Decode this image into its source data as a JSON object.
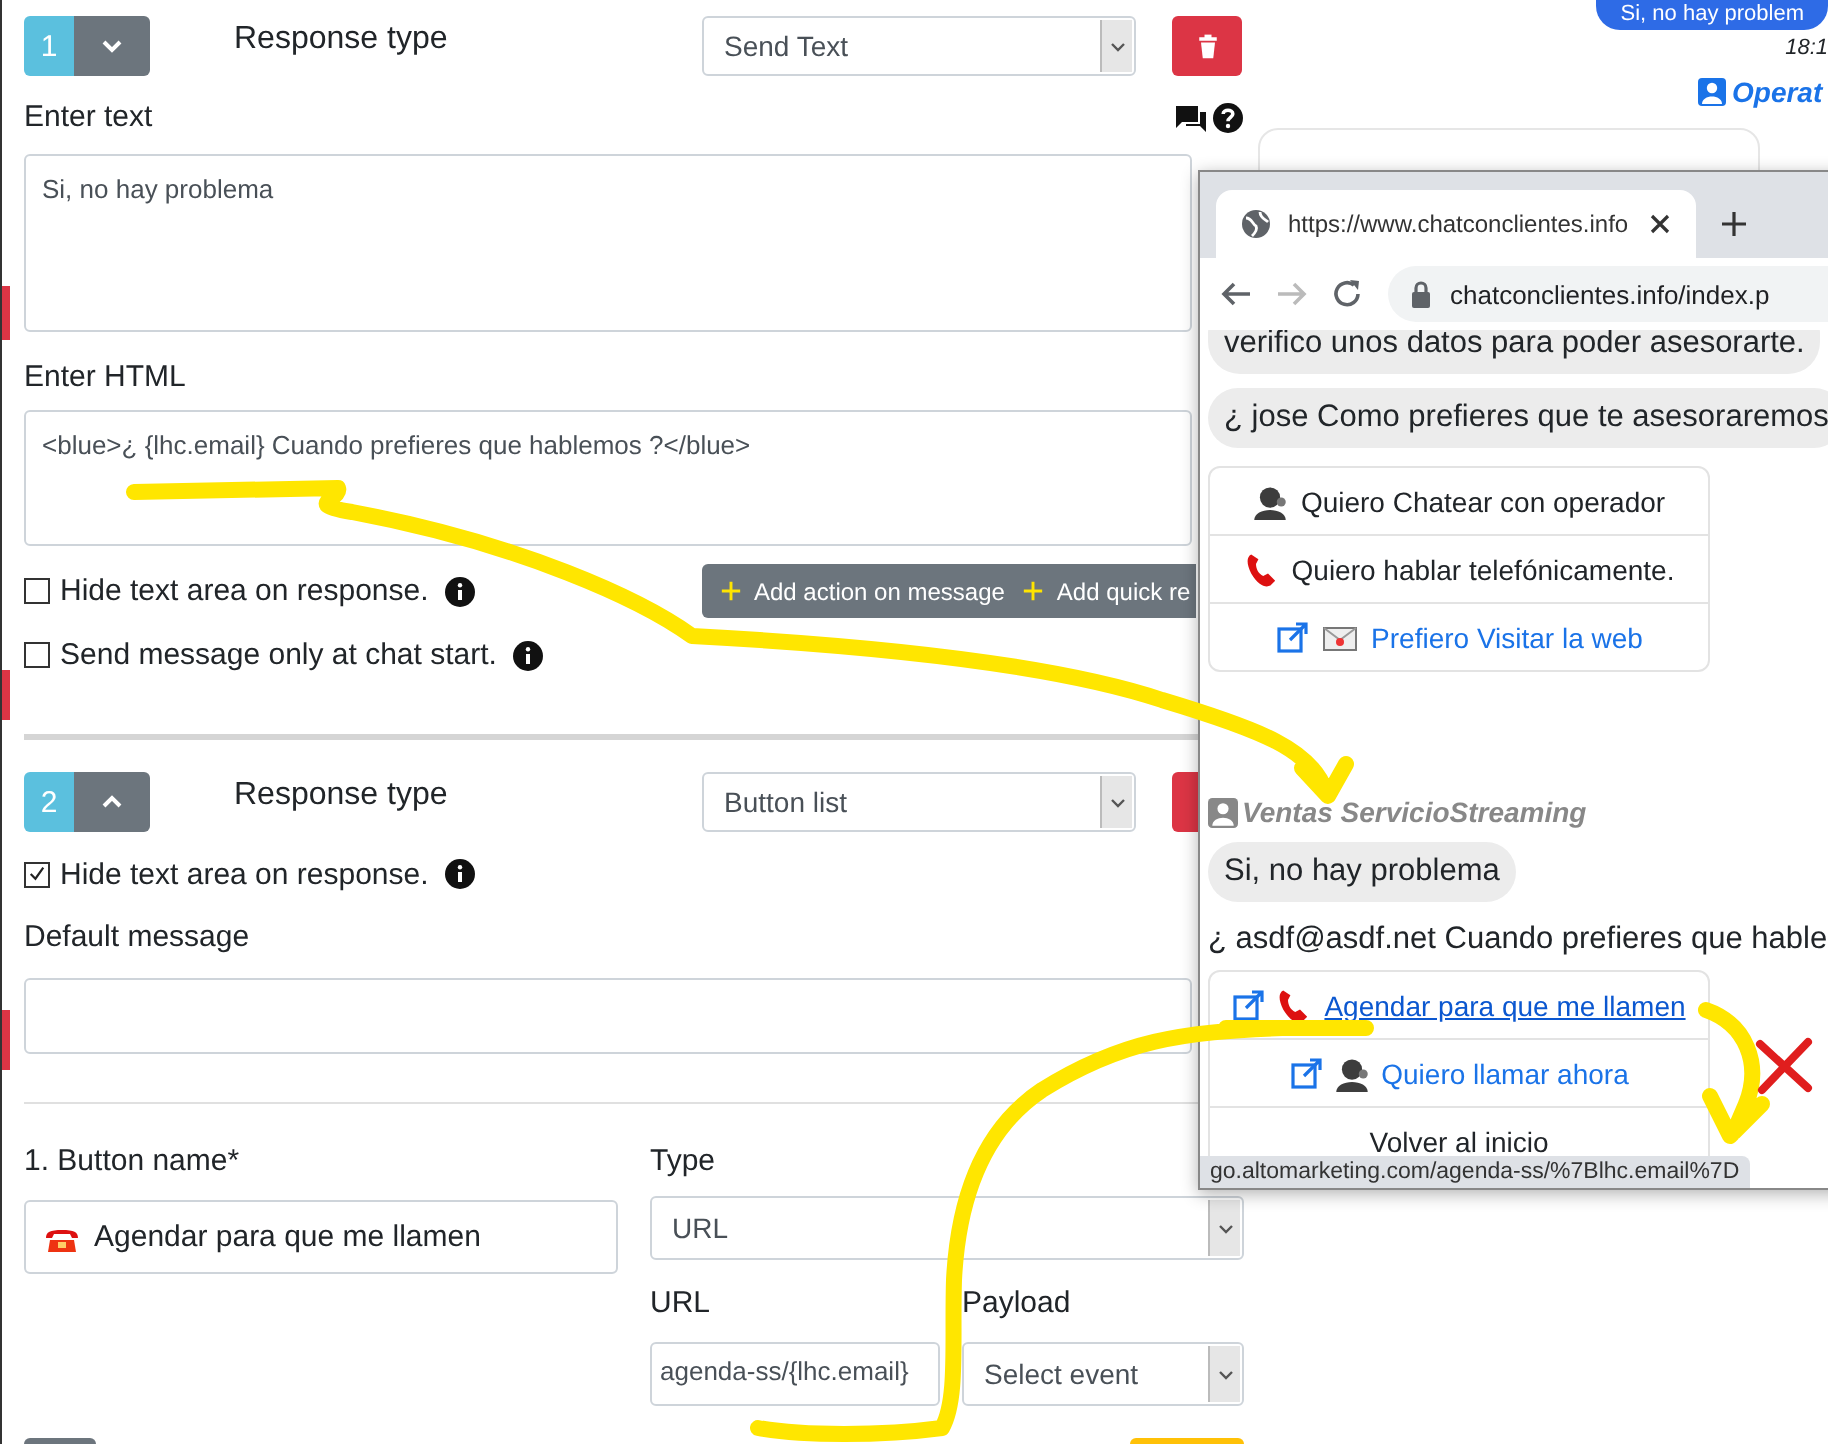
{
  "editor": {
    "responses": [
      {
        "number": "1",
        "expanded": false,
        "kind": "text",
        "type_label": "Response type",
        "type_value": "Send Text",
        "fields": [
          {
            "label": "Enter text",
            "value": "Si, no hay problema",
            "kind": "textarea"
          },
          {
            "label": "Enter HTML",
            "value": "<blue>¿ {lhc.email} Cuando prefieres que hablemos ?</blue>",
            "kind": "textarea"
          }
        ],
        "checkboxes": [
          {
            "label": "Hide text area on response.",
            "checked": false
          },
          {
            "label": "Send message only at chat start.",
            "checked": false
          }
        ],
        "actions": [
          "Add action on message",
          "Add quick re"
        ]
      },
      {
        "number": "2",
        "expanded": true,
        "kind": "buttons",
        "type_label": "Response type",
        "type_value": "Button list",
        "checkboxes": [
          {
            "label": "Hide text area on response.",
            "checked": true
          }
        ],
        "fields": [
          {
            "label": "Default message",
            "kind": "input"
          }
        ],
        "button_item": {
          "name_label": "1. Button name*",
          "name_value": "Agendar para que me llamen",
          "type_label": "Type",
          "type_value": "URL",
          "url_label": "URL",
          "url_value": "agenda-ss/{lhc.email}",
          "payload_label": "Payload",
          "payload_value": "Select event"
        }
      }
    ]
  },
  "chat_background": {
    "bubble": "Si, no hay problem",
    "time": "18:1",
    "sender": "Operat"
  },
  "browser": {
    "tab_title": "https://www.chatconclientes.info",
    "address": "chatconclientes.info/index.p",
    "status_url": "go.altomarketing.com/agenda-ss/%7Blhc.email%7D",
    "messages": [
      {
        "kind": "bubble",
        "text": "verifico unos datos para poder asesorarte."
      },
      {
        "kind": "bubble",
        "text": "¿ jose Como prefieres que te asesoraremos"
      },
      {
        "kind": "buttons",
        "buttons": [
          {
            "text": "Quiero Chatear con operador",
            "kind": "operator",
            "link": false,
            "hovered": false
          },
          {
            "text": "Quiero hablar telefónicamente.",
            "kind": "phone",
            "link": false,
            "hovered": false
          },
          {
            "text": "Prefiero Visitar la web",
            "kind": "envelope",
            "link": true,
            "hovered": false
          }
        ]
      },
      {
        "kind": "sender",
        "text": "Ventas ServicioStreaming"
      },
      {
        "kind": "bubble",
        "text": "Si, no hay problema"
      },
      {
        "kind": "plain",
        "text": "¿ asdf@asdf.net Cuando prefieres que hable"
      },
      {
        "kind": "buttons",
        "buttons": [
          {
            "text": "Agendar para que me llamen",
            "kind": "phone",
            "link": true,
            "hovered": true
          },
          {
            "text": "Quiero llamar ahora",
            "kind": "operator",
            "link": true,
            "hovered": false
          },
          {
            "text": "Volver al inicio",
            "kind": "plain",
            "link": false,
            "hovered": false
          }
        ]
      }
    ]
  }
}
